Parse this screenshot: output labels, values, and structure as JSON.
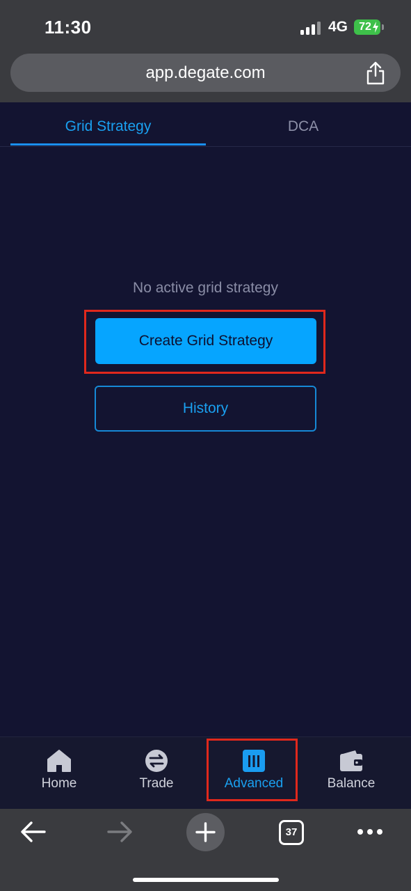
{
  "status_bar": {
    "time": "11:30",
    "network": "4G",
    "battery": "72"
  },
  "browser": {
    "url": "app.degate.com",
    "tab_count": "37"
  },
  "tabs": [
    {
      "label": "Grid Strategy",
      "active": true
    },
    {
      "label": "DCA",
      "active": false
    }
  ],
  "main": {
    "empty_message": "No active grid strategy",
    "create_button": "Create Grid Strategy",
    "history_button": "History"
  },
  "nav": [
    {
      "label": "Home",
      "icon": "home-icon",
      "active": false
    },
    {
      "label": "Trade",
      "icon": "swap-icon",
      "active": false
    },
    {
      "label": "Advanced",
      "icon": "bar-chart-icon",
      "active": true
    },
    {
      "label": "Balance",
      "icon": "wallet-icon",
      "active": false
    }
  ],
  "colors": {
    "background": "#131431",
    "accent": "#06a5ff",
    "highlight": "#e0281c"
  }
}
